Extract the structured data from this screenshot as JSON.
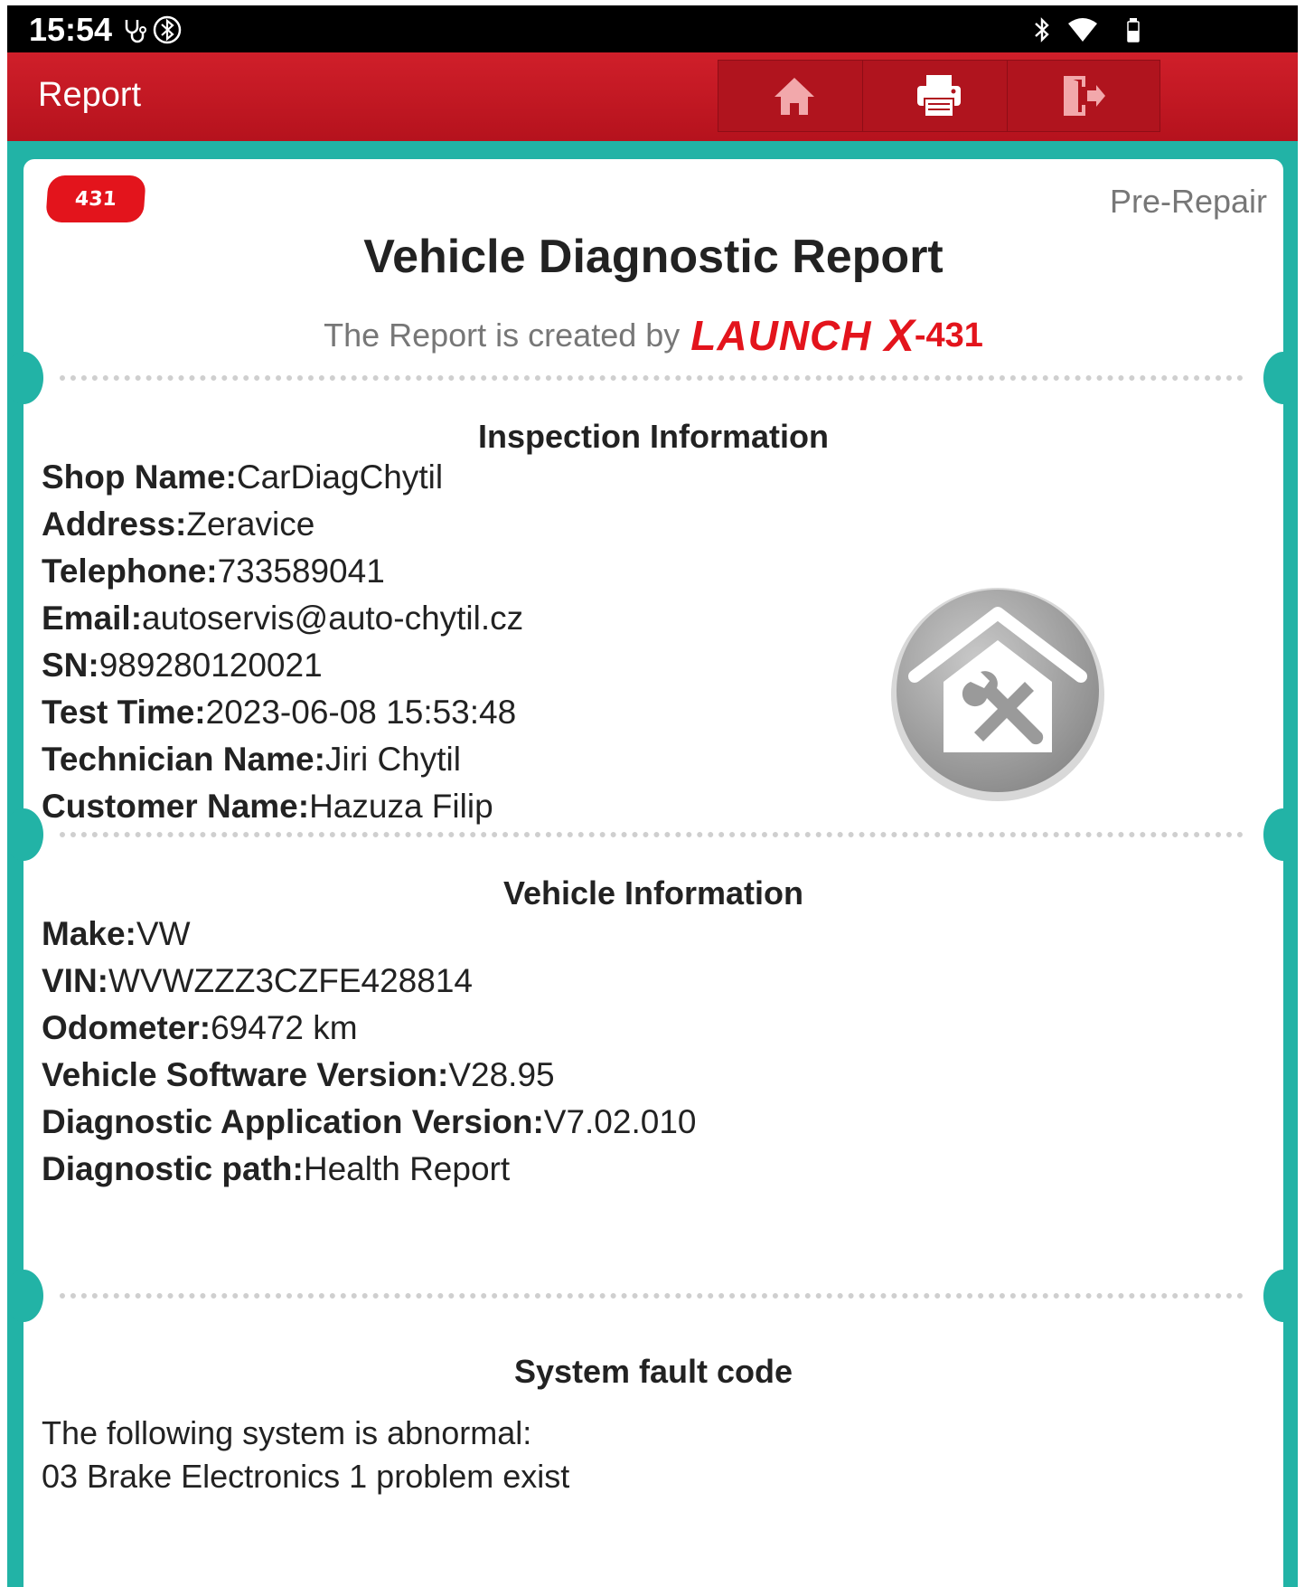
{
  "status_bar": {
    "time": "15:54"
  },
  "app_bar": {
    "title": "Report"
  },
  "report": {
    "badge": "431",
    "stage": "Pre-Repair",
    "title": "Vehicle Diagnostic Report",
    "subtitle": "The Report is created by",
    "brand": {
      "name": "LAUNCH",
      "x": "X",
      "model": "-431"
    }
  },
  "inspection": {
    "heading": "Inspection Information",
    "rows": [
      {
        "key": "Shop Name:",
        "value": "CarDiagChytil"
      },
      {
        "key": "Address:",
        "value": "Zeravice"
      },
      {
        "key": "Telephone:",
        "value": "733589041"
      },
      {
        "key": "Email:",
        "value": "autoservis@auto-chytil.cz"
      },
      {
        "key": "SN:",
        "value": "989280120021"
      },
      {
        "key": "Test Time:",
        "value": "2023-06-08 15:53:48"
      },
      {
        "key": "Technician Name:",
        "value": "Jiri Chytil"
      },
      {
        "key": "Customer Name:",
        "value": "Hazuza Filip"
      }
    ]
  },
  "vehicle": {
    "heading": "Vehicle Information",
    "rows": [
      {
        "key": "Make:",
        "value": "VW"
      },
      {
        "key": "VIN:",
        "value": "WVWZZZ3CZFE428814"
      },
      {
        "key": "Odometer:",
        "value": "69472 km"
      },
      {
        "key": "Vehicle Software Version:",
        "value": "V28.95"
      },
      {
        "key": "Diagnostic Application Version:",
        "value": "V7.02.010"
      },
      {
        "key": "Diagnostic path:",
        "value": "Health Report"
      }
    ]
  },
  "faults": {
    "heading": "System fault code",
    "intro": "The following system is abnormal:",
    "line": "03 Brake Electronics 1 problem exist"
  },
  "colors": {
    "accent_red": "#d01f2a",
    "frame_teal": "#22b3a6",
    "brand_red": "#e3141c"
  }
}
